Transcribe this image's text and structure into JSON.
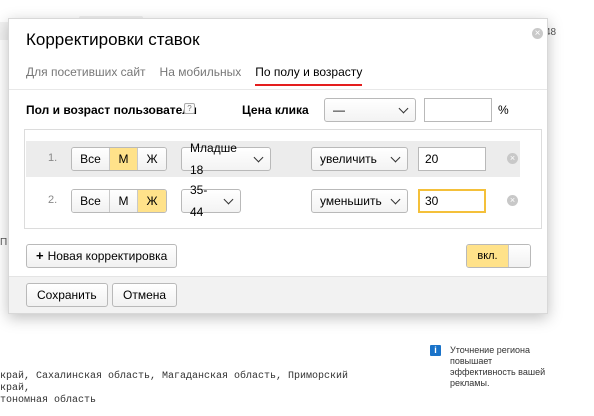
{
  "background": {
    "fragment_top": "48",
    "fragment_left": "П",
    "regions_text": "край, Сахалинская область, Магаданская область, Приморский край,\nтономная область",
    "hint_icon": "info-icon",
    "hint_text": "Уточнение региона повышает эффективность вашей рекламы."
  },
  "dialog": {
    "title": "Корректировки ставок",
    "tabs": [
      {
        "label": "Для посетивших сайт",
        "active": false
      },
      {
        "label": "На мобильных",
        "active": false
      },
      {
        "label": "По полу и возрасту",
        "active": true
      }
    ],
    "header": {
      "label": "Пол и возраст пользователя",
      "help": "?",
      "price_label": "Цена клика",
      "price_select": "—",
      "price_input": "",
      "percent": "%"
    },
    "rows": [
      {
        "num": "1.",
        "gender": {
          "all": "Все",
          "male": "М",
          "female": "Ж",
          "selected": "М"
        },
        "age": "Младше 18",
        "direction": "увеличить",
        "value": "20"
      },
      {
        "num": "2.",
        "gender": {
          "all": "Все",
          "male": "М",
          "female": "Ж",
          "selected": "Ж"
        },
        "age": "35-44",
        "direction": "уменьшить",
        "value": "30"
      }
    ],
    "add_button": "Новая корректировка",
    "toggle_label": "вкл.",
    "save_button": "Сохранить",
    "cancel_button": "Отмена"
  },
  "colors": {
    "accent_tab": "#e41e1e",
    "selected_yellow": "#ffe28a",
    "focus_yellow": "#f4c03a"
  }
}
